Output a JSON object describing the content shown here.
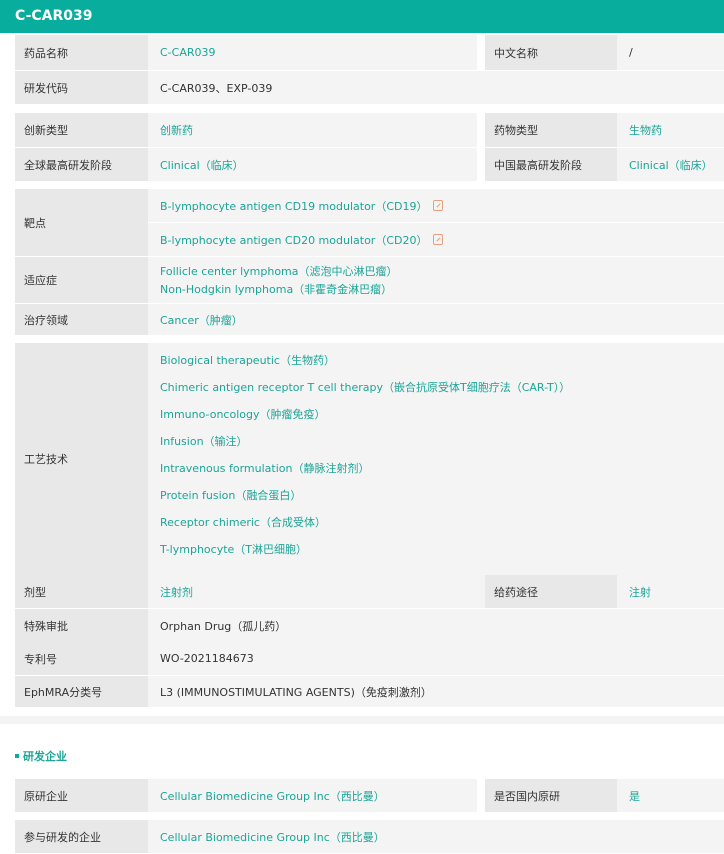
{
  "title": "C-CAR039",
  "basic": {
    "drug_name_label": "药品名称",
    "drug_name": "C-CAR039",
    "cn_name_label": "中文名称",
    "cn_name": "/",
    "code_label": "研发代码",
    "code": "C-CAR039、EXP-039",
    "innov_label": "创新类型",
    "innov": "创新药",
    "drug_type_label": "药物类型",
    "drug_type": "生物药",
    "global_stage_label": "全球最高研发阶段",
    "global_stage": "Clinical（临床）",
    "cn_stage_label": "中国最高研发阶段",
    "cn_stage": "Clinical（临床）",
    "target_label": "靶点",
    "targets": [
      "B-lymphocyte antigen CD19 modulator（CD19）",
      "B-lymphocyte antigen CD20 modulator（CD20）"
    ],
    "indication_label": "适应症",
    "indications": [
      "Follicle center lymphoma（滤泡中心淋巴瘤）",
      "Non-Hodgkin lymphoma（非霍奇金淋巴瘤）"
    ],
    "area_label": "治疗领域",
    "area": "Cancer（肿瘤）",
    "tech_label": "工艺技术",
    "techs": [
      "Biological therapeutic（生物药）",
      "Chimeric antigen receptor T cell therapy（嵌合抗原受体T细胞疗法（CAR-T））",
      "Immuno-oncology（肿瘤免疫）",
      "Infusion（输注）",
      "Intravenous formulation（静脉注射剂）",
      "Protein fusion（融合蛋白）",
      "Receptor chimeric（合成受体）",
      "T-lymphocyte（T淋巴细胞）"
    ],
    "form_label": "剂型",
    "form": "注射剂",
    "route_label": "给药途径",
    "route": "注射",
    "special_label": "特殊审批",
    "special": "Orphan Drug（孤儿药）",
    "patent_label": "专利号",
    "patent": "WO-2021184673",
    "ephmra_label": "EphMRA分类号",
    "ephmra": "L3 (IMMUNOSTIMULATING AGENTS)（免疫刺激剂）"
  },
  "company": {
    "section_title": "研发企业",
    "orig_label": "原研企业",
    "orig": "Cellular Biomedicine Group Inc（西比曼）",
    "domestic_label": "是否国内原研",
    "domestic": "是",
    "partner_label": "参与研发的企业",
    "partner": "Cellular Biomedicine Group Inc（西比曼）"
  }
}
